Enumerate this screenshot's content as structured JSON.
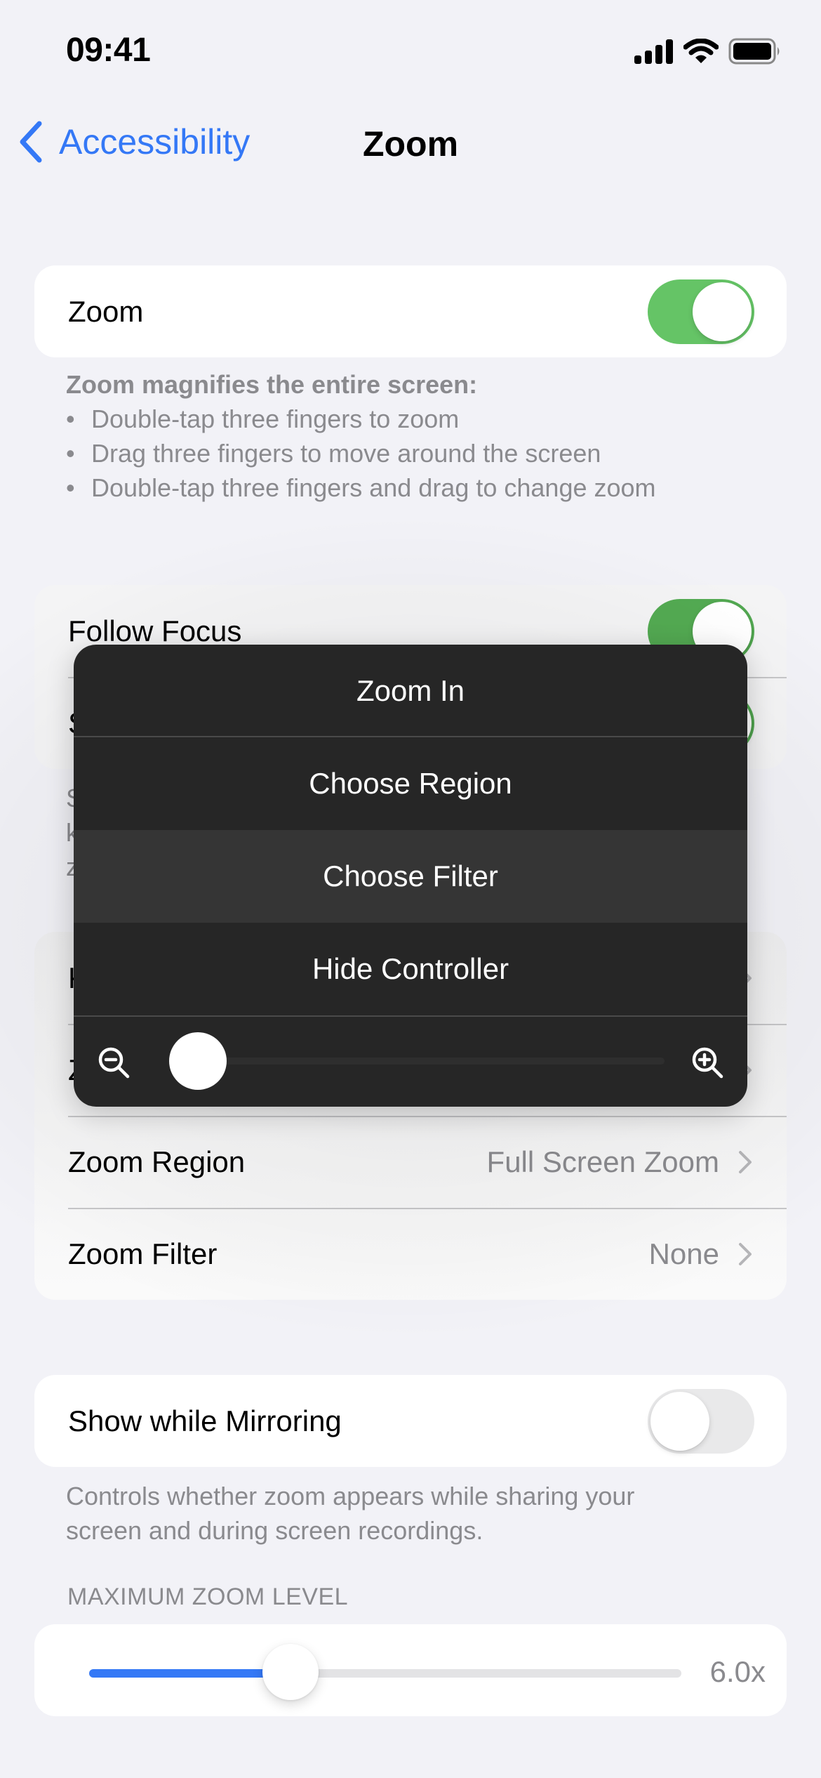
{
  "status_bar": {
    "time": "09:41",
    "icons": [
      "cellular-signal-icon",
      "wifi-icon",
      "battery-icon"
    ]
  },
  "nav": {
    "back_label": "Accessibility",
    "title": "Zoom"
  },
  "zoom_group": {
    "label": "Zoom",
    "toggle_on": true
  },
  "zoom_footer": {
    "heading": "Zoom magnifies the entire screen:",
    "bullet_char": "•",
    "bullets": [
      "Double-tap three fingers to zoom",
      "Drag three fingers to move around the screen",
      "Double-tap three fingers and drag to change zoom"
    ]
  },
  "focus_group": {
    "rows": [
      {
        "label": "Follow Focus",
        "toggle_on": true
      },
      {
        "label": "S",
        "toggle_on": true
      }
    ]
  },
  "focus_footer": {
    "lines": [
      "S",
      "k",
      "z"
    ]
  },
  "options_group": {
    "rows": [
      {
        "label": "K",
        "value": ""
      },
      {
        "label": "Z",
        "value": ""
      },
      {
        "label": "Zoom Region",
        "value": "Full Screen Zoom"
      },
      {
        "label": "Zoom Filter",
        "value": "None"
      }
    ]
  },
  "mirroring_group": {
    "label": "Show while Mirroring",
    "toggle_on": false
  },
  "mirroring_footer": {
    "text_line1": "Controls whether zoom appears while sharing your",
    "text_line2": "screen and during screen recordings."
  },
  "max_zoom": {
    "header": "MAXIMUM ZOOM LEVEL",
    "value_label": "6.0x",
    "fraction": 0.34
  },
  "controller_menu": {
    "items": [
      {
        "label": "Zoom In",
        "highlighted": false
      },
      {
        "label": "Choose Region",
        "highlighted": false
      },
      {
        "label": "Choose Filter",
        "highlighted": true
      },
      {
        "label": "Hide Controller",
        "highlighted": false
      }
    ],
    "zoom_slider_fraction": 0.0,
    "zoom_out_icon": "zoom-out-icon",
    "zoom_in_icon": "zoom-in-icon"
  },
  "colors": {
    "accent": "#3478F6",
    "toggle_on": "#65C466",
    "background": "#F2F2F7",
    "menu_bg": "#262626",
    "menu_highlight": "#353535",
    "secondary_text": "#8A8A8E"
  }
}
